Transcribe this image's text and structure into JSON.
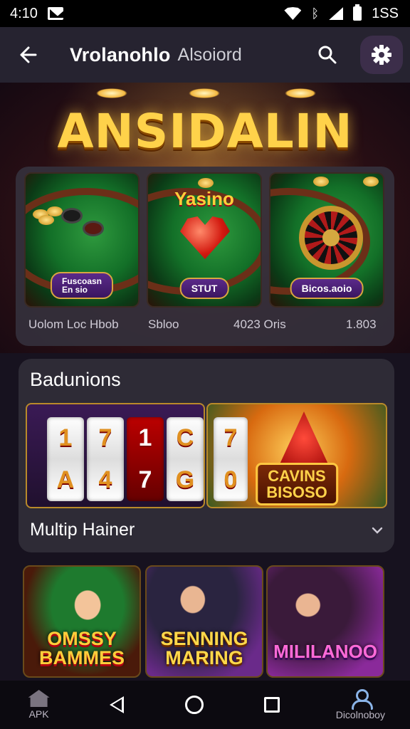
{
  "status_bar": {
    "time": "4:10",
    "battery": "1SS"
  },
  "app_bar": {
    "title": "Vrolanohlo",
    "subtitle": "Alsoiord"
  },
  "hero": {
    "title": "ANSIDALIN"
  },
  "games": [
    {
      "badge": "Fuscoasn\nEn sio",
      "label": "Uolom Loc Hbob"
    },
    {
      "logo": "Yasino",
      "badge": "STUT",
      "label": "Sbloo"
    },
    {
      "badge": "Bicos.aoio",
      "label": "4023 Oris",
      "extra": "1.803"
    }
  ],
  "promotions": {
    "heading": "Badunions",
    "casino_sign": "CAVINS\nBISOSO"
  },
  "slots_symbols": [
    [
      "1",
      "A"
    ],
    [
      "7",
      "4"
    ],
    [
      "1",
      "7"
    ],
    [
      "C",
      "G"
    ],
    [
      "7",
      "0"
    ]
  ],
  "multiplayer": {
    "label": "Multip Hainer",
    "tiles": [
      {
        "text": "OMSSY\nBAMMES"
      },
      {
        "text": "SENNING\nMARING"
      },
      {
        "text": "MILILANOO"
      }
    ]
  },
  "nav": {
    "left_caption": "APK",
    "right_caption": "Dicolnoboy"
  },
  "colors": {
    "accent": "#3c2e4a",
    "gold": "#ffd24a",
    "panel": "#2e2b36"
  }
}
